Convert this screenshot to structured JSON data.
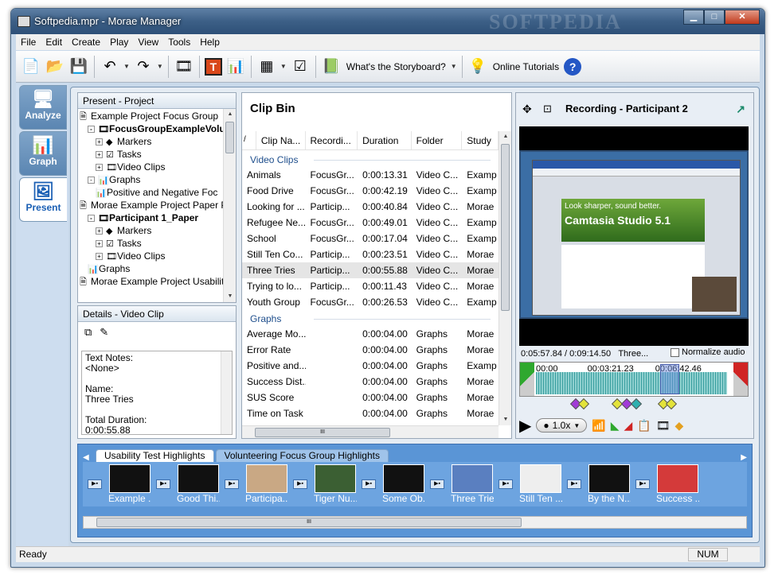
{
  "window": {
    "title": "Softpedia.mpr - Morae Manager",
    "watermark": "SOFTPEDIA"
  },
  "menu": [
    "File",
    "Edit",
    "Create",
    "Play",
    "View",
    "Tools",
    "Help"
  ],
  "toolbar": {
    "storyboard_label": "What's the Storyboard?",
    "tutorials_label": "Online Tutorials"
  },
  "sidetabs": {
    "analyze": "Analyze",
    "graph": "Graph",
    "present": "Present"
  },
  "project": {
    "header": "Present - Project",
    "items": [
      {
        "label": "Example Project Focus Group",
        "level": 0,
        "icon": "doc-icon",
        "bold": false,
        "exp": ""
      },
      {
        "label": "FocusGroupExampleVolunt",
        "level": 1,
        "icon": "film-icon",
        "bold": true,
        "exp": "-"
      },
      {
        "label": "Markers",
        "level": 2,
        "icon": "marker-icon",
        "bold": false,
        "exp": "+"
      },
      {
        "label": "Tasks",
        "level": 2,
        "icon": "task-icon",
        "bold": false,
        "exp": "+"
      },
      {
        "label": "Video Clips",
        "level": 2,
        "icon": "film-icon",
        "bold": false,
        "exp": "+"
      },
      {
        "label": "Graphs",
        "level": 1,
        "icon": "graph-icon",
        "bold": false,
        "exp": "-"
      },
      {
        "label": "Positive and Negative Foc",
        "level": 2,
        "icon": "graph-icon",
        "bold": false,
        "exp": ""
      },
      {
        "label": "Morae Example Project Paper Prot",
        "level": 0,
        "icon": "doc-icon",
        "bold": false,
        "exp": ""
      },
      {
        "label": "Participant 1_Paper",
        "level": 1,
        "icon": "film-icon",
        "bold": true,
        "exp": "-"
      },
      {
        "label": "Markers",
        "level": 2,
        "icon": "marker-icon",
        "bold": false,
        "exp": "+"
      },
      {
        "label": "Tasks",
        "level": 2,
        "icon": "task-icon",
        "bold": false,
        "exp": "+"
      },
      {
        "label": "Video Clips",
        "level": 2,
        "icon": "film-icon",
        "bold": false,
        "exp": "+"
      },
      {
        "label": "Graphs",
        "level": 1,
        "icon": "graph-icon",
        "bold": false,
        "exp": ""
      },
      {
        "label": "Morae Example Project Usability T",
        "level": 0,
        "icon": "doc-icon",
        "bold": false,
        "exp": ""
      }
    ]
  },
  "details": {
    "header": "Details - Video Clip",
    "lines": [
      "Text Notes:",
      "<None>",
      "",
      "Name:",
      "Three Tries",
      "",
      "Total Duration:",
      "0:00:55.88"
    ]
  },
  "clipbin": {
    "title": "Clip Bin",
    "columns": [
      "Clip Na...",
      "Recordi...",
      "Duration",
      "Folder",
      "Study"
    ],
    "groups": [
      {
        "name": "Video Clips",
        "rows": [
          [
            "Animals",
            "FocusGr...",
            "0:00:13.31",
            "Video C...",
            "Examp"
          ],
          [
            "Food Drive",
            "FocusGr...",
            "0:00:42.19",
            "Video C...",
            "Examp"
          ],
          [
            "Looking for ...",
            "Particip...",
            "0:00:40.84",
            "Video C...",
            "Morae"
          ],
          [
            "Refugee Ne...",
            "FocusGr...",
            "0:00:49.01",
            "Video C...",
            "Examp"
          ],
          [
            "School",
            "FocusGr...",
            "0:00:17.04",
            "Video C...",
            "Examp"
          ],
          [
            "Still Ten Co...",
            "Particip...",
            "0:00:23.51",
            "Video C...",
            "Morae"
          ],
          [
            "Three Tries",
            "Particip...",
            "0:00:55.88",
            "Video C...",
            "Morae"
          ],
          [
            "Trying to lo...",
            "Particip...",
            "0:00:11.43",
            "Video C...",
            "Morae"
          ],
          [
            "Youth Group",
            "FocusGr...",
            "0:00:26.53",
            "Video C...",
            "Examp"
          ]
        ]
      },
      {
        "name": "Graphs",
        "rows": [
          [
            "Average Mo...",
            "",
            "0:00:04.00",
            "Graphs",
            "Morae"
          ],
          [
            "Error Rate",
            "",
            "0:00:04.00",
            "Graphs",
            "Morae"
          ],
          [
            "Positive and...",
            "",
            "0:00:04.00",
            "Graphs",
            "Examp"
          ],
          [
            "Success Dist...",
            "",
            "0:00:04.00",
            "Graphs",
            "Morae"
          ],
          [
            "SUS Score",
            "",
            "0:00:04.00",
            "Graphs",
            "Morae"
          ],
          [
            "Time on Task",
            "",
            "0:00:04.00",
            "Graphs",
            "Morae"
          ]
        ]
      }
    ],
    "selected": "Three Tries"
  },
  "player": {
    "title": "Recording - Participant 2",
    "time": "0:05:57.84 / 0:09:14.50",
    "clip": "Three...",
    "normalize_label": "Normalize audio",
    "ticks": [
      "00:00",
      "00:03:21.23",
      "00:06:42.46"
    ],
    "speed": "1.0x",
    "banner_sub": "Look sharper, sound better.",
    "banner_title": "Camtasia Studio 5.1"
  },
  "storyboard": {
    "tabs": [
      "Usability Test Highlights",
      "Volunteering Focus Group Highlights"
    ],
    "items": [
      "Example ...",
      "Good Thi...",
      "Participa...",
      "Tiger Nu...",
      "Some Ob...",
      "Three Tries",
      "Still Ten ...",
      "By the N...",
      "Success ..."
    ]
  },
  "status": {
    "text": "Ready",
    "num": "NUM"
  }
}
